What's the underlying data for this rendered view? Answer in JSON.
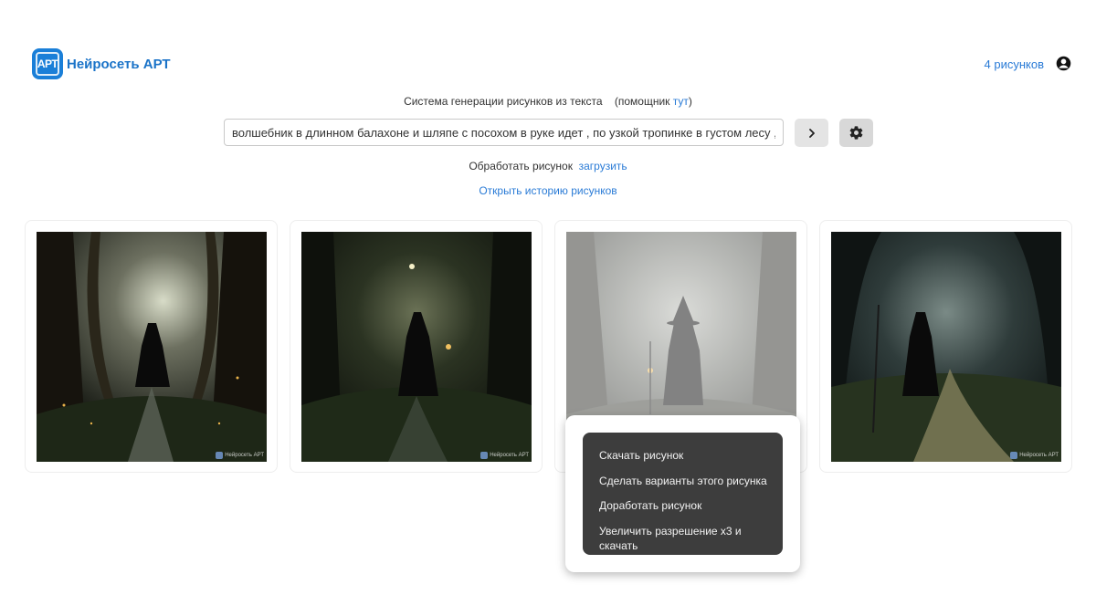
{
  "header": {
    "logo_badge": "АРТ",
    "logo_text": "Нейросеть АРТ",
    "image_count": "4 рисунков"
  },
  "subtitle": {
    "text": "Система генерации рисунков из текста",
    "helper_open": "(помощник ",
    "helper_link": "тут",
    "helper_close": ")"
  },
  "prompt": {
    "value": "волшебник в длинном балахоне и шляпе с посохом в руке идет , по узкой тропинке в густом лесу , фотореалистично"
  },
  "process": {
    "label": "Обработать рисунок",
    "link": "загрузить"
  },
  "history_link": "Открыть историю рисунков",
  "watermark": "Нейросеть АРТ",
  "context_menu": {
    "items": [
      "Скачать рисунок",
      "Сделать варианты этого рисунка",
      "Доработать рисунок",
      "Увеличить разрешение x3 и скачать"
    ]
  }
}
